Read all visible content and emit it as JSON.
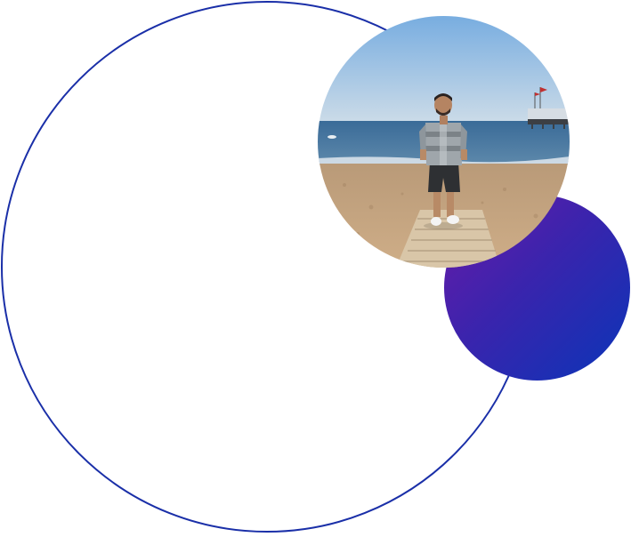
{
  "decor": {
    "ring_color": "#1a2fa8",
    "disc_gradient": [
      "#6a1aa8",
      "#3a24ad",
      "#0a35b8"
    ]
  },
  "photo": {
    "subject": "person-standing-on-beach-boardwalk",
    "scene_colors": {
      "sky_top": "#7fb2e2",
      "sky_bottom": "#c9dbe8",
      "sea": "#3d6f9c",
      "sand": "#c9a67f",
      "boardwalk": "#d8c4a6"
    }
  }
}
